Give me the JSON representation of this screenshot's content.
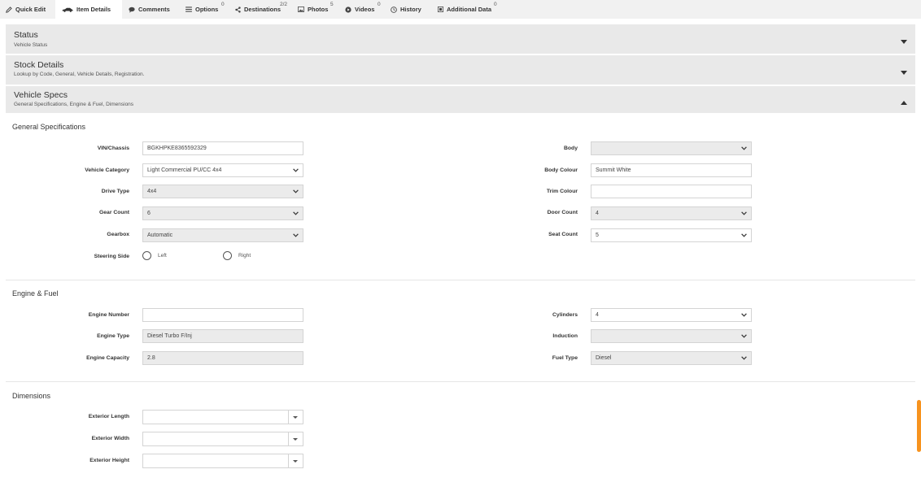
{
  "tabs": [
    {
      "label": "Quick Edit",
      "icon": "pencil-icon",
      "badge": ""
    },
    {
      "label": "Item Details",
      "icon": "car-icon",
      "badge": ""
    },
    {
      "label": "Comments",
      "icon": "comment-icon",
      "badge": "0"
    },
    {
      "label": "Options",
      "icon": "list-icon",
      "badge": ""
    },
    {
      "label": "Destinations",
      "icon": "share-icon",
      "badge": "2/2"
    },
    {
      "label": "Photos",
      "icon": "image-icon",
      "badge": "5"
    },
    {
      "label": "Videos",
      "icon": "play-icon",
      "badge": "0"
    },
    {
      "label": "History",
      "icon": "clock-icon",
      "badge": ""
    },
    {
      "label": "Additional Data",
      "icon": "data-icon",
      "badge": "0"
    }
  ],
  "panels": {
    "status": {
      "title": "Status",
      "subtitle": "Vehicle Status"
    },
    "stock": {
      "title": "Stock Details",
      "subtitle": "Lookup by Code, General, Vehicle Details, Registration."
    },
    "specs": {
      "title": "Vehicle Specs",
      "subtitle": "General Specifications, Engine & Fuel, Dimensions"
    }
  },
  "general": {
    "title": "General Specifications",
    "vin": {
      "label": "VIN/Chassis",
      "value": "BGKHPKE8365592329"
    },
    "category": {
      "label": "Vehicle Category",
      "value": "Light Commercial PU/CC 4x4"
    },
    "drive": {
      "label": "Drive Type",
      "value": "4x4"
    },
    "gear_count": {
      "label": "Gear Count",
      "value": "6"
    },
    "gearbox": {
      "label": "Gearbox",
      "value": "Automatic"
    },
    "steering": {
      "label": "Steering Side",
      "left": "Left",
      "right": "Right"
    },
    "body": {
      "label": "Body",
      "value": ""
    },
    "body_colour": {
      "label": "Body Colour",
      "value": "Summit White"
    },
    "trim_colour": {
      "label": "Trim Colour",
      "value": ""
    },
    "door_count": {
      "label": "Door Count",
      "value": "4"
    },
    "seat_count": {
      "label": "Seat Count",
      "value": "5"
    }
  },
  "engine": {
    "title": "Engine & Fuel",
    "number": {
      "label": "Engine Number",
      "value": ""
    },
    "type": {
      "label": "Engine Type",
      "value": "Diesel Turbo F/Inj"
    },
    "capacity": {
      "label": "Engine Capacity",
      "value": "2.8"
    },
    "cylinders": {
      "label": "Cylinders",
      "value": "4"
    },
    "induction": {
      "label": "Induction",
      "value": ""
    },
    "fuel": {
      "label": "Fuel Type",
      "value": "Diesel"
    }
  },
  "dimensions": {
    "title": "Dimensions",
    "length": {
      "label": "Exterior Length",
      "value": ""
    },
    "width": {
      "label": "Exterior Width",
      "value": ""
    },
    "height": {
      "label": "Exterior Height",
      "value": ""
    }
  },
  "colors": {
    "accent": "#f7931e",
    "panel": "#e9e9e9",
    "tabbar": "#f1f1f1"
  }
}
